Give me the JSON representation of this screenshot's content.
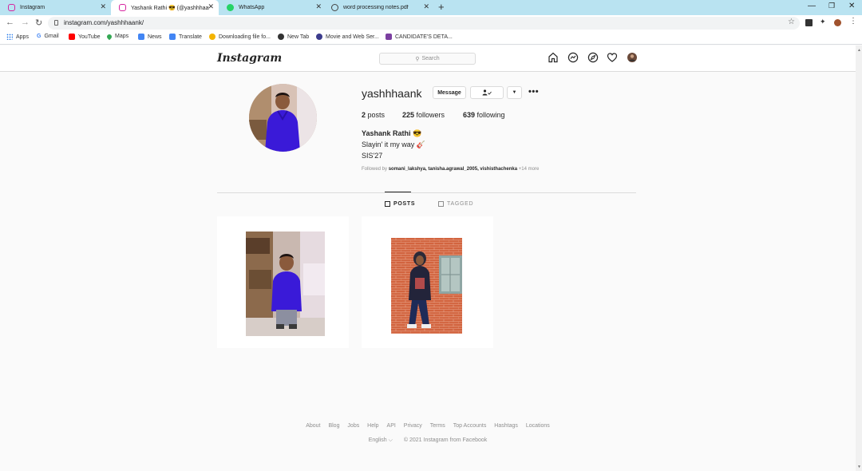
{
  "browser": {
    "tabs": [
      {
        "title": "Instagram",
        "active": false
      },
      {
        "title": "Yashank Rathi 😎 (@yashhhaank)",
        "active": true
      },
      {
        "title": "WhatsApp",
        "active": false
      },
      {
        "title": "word processing notes.pdf",
        "active": false
      }
    ],
    "new_tab": "+",
    "url": "instagram.com/yashhhaank/",
    "bookmarks": [
      {
        "label": "Apps",
        "icon": "apps-grid-icon",
        "color": "#1a73e8"
      },
      {
        "label": "Gmail",
        "icon": "google-icon",
        "color": "#ea4335"
      },
      {
        "label": "YouTube",
        "icon": "youtube-icon",
        "color": "#ff0000"
      },
      {
        "label": "Maps",
        "icon": "maps-icon",
        "color": "#34a853"
      },
      {
        "label": "News",
        "icon": "news-icon",
        "color": "#4285f4"
      },
      {
        "label": "Translate",
        "icon": "translate-icon",
        "color": "#4285f4"
      },
      {
        "label": "Downloading file fo...",
        "icon": "bookmark-icon",
        "color": "#f4b400"
      },
      {
        "label": "New Tab",
        "icon": "globe-icon",
        "color": "#333333"
      },
      {
        "label": "Movie and Web Ser...",
        "icon": "bookmark-icon",
        "color": "#3c3c8c"
      },
      {
        "label": "CANDIDATE'S DETA...",
        "icon": "bookmark-icon",
        "color": "#7b3fa0"
      }
    ]
  },
  "instagram": {
    "logo": "Instagram",
    "search_placeholder": "Search",
    "profile": {
      "username": "yashhhaank",
      "message_button": "Message",
      "more": "•••",
      "stats": {
        "posts_count": "2",
        "posts_label": "posts",
        "followers_count": "225",
        "followers_label": "followers",
        "following_count": "639",
        "following_label": "following"
      },
      "full_name": "Yashank Rathi 😎",
      "bio_lines": [
        "Slayin' it my way 🎸",
        "SIS'27"
      ],
      "followed_by_prefix": "Followed by",
      "followed_by_users": "somani_lakshya, tanisha.agrawal_2005, vishisthachenka",
      "followed_by_more": "+14 more"
    },
    "tabs": [
      {
        "label": "POSTS",
        "icon": "grid-icon"
      },
      {
        "label": "TAGGED",
        "icon": "tag-icon"
      }
    ],
    "footer": {
      "links": [
        "About",
        "Blog",
        "Jobs",
        "Help",
        "API",
        "Privacy",
        "Terms",
        "Top Accounts",
        "Hashtags",
        "Locations"
      ],
      "language": "English ⌵",
      "copyright": "© 2021 Instagram from Facebook"
    }
  },
  "colors": {
    "tabstrip": "#b9e3f1",
    "ig_border": "#dbdbdb",
    "ig_text": "#262626",
    "ig_muted": "#8e8e8e"
  }
}
